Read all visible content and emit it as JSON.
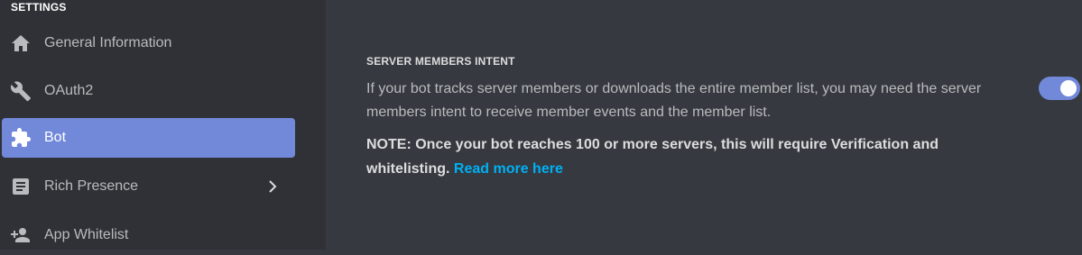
{
  "sidebar": {
    "header": "SETTINGS",
    "items": [
      {
        "label": "General Information",
        "icon": "home-icon",
        "active": false
      },
      {
        "label": "OAuth2",
        "icon": "wrench-icon",
        "active": false
      },
      {
        "label": "Bot",
        "icon": "puzzle-icon",
        "active": true
      },
      {
        "label": "Rich Presence",
        "icon": "document-icon",
        "active": false,
        "has_submenu": true
      },
      {
        "label": "App Whitelist",
        "icon": "person-add-icon",
        "active": false
      }
    ]
  },
  "main": {
    "section_title": "SERVER MEMBERS INTENT",
    "description": "If your bot tracks server members or downloads the entire member list, you may need the server members intent to receive member events and the member list.",
    "note_text": "NOTE: Once your bot reaches 100 or more servers, this will require Verification and whitelisting.",
    "note_link": "Read more here",
    "toggle_enabled": true
  },
  "colors": {
    "accent": "#7289da",
    "link": "#00b0f4",
    "background": "#36393f",
    "sidebar_background": "#2f3136"
  }
}
